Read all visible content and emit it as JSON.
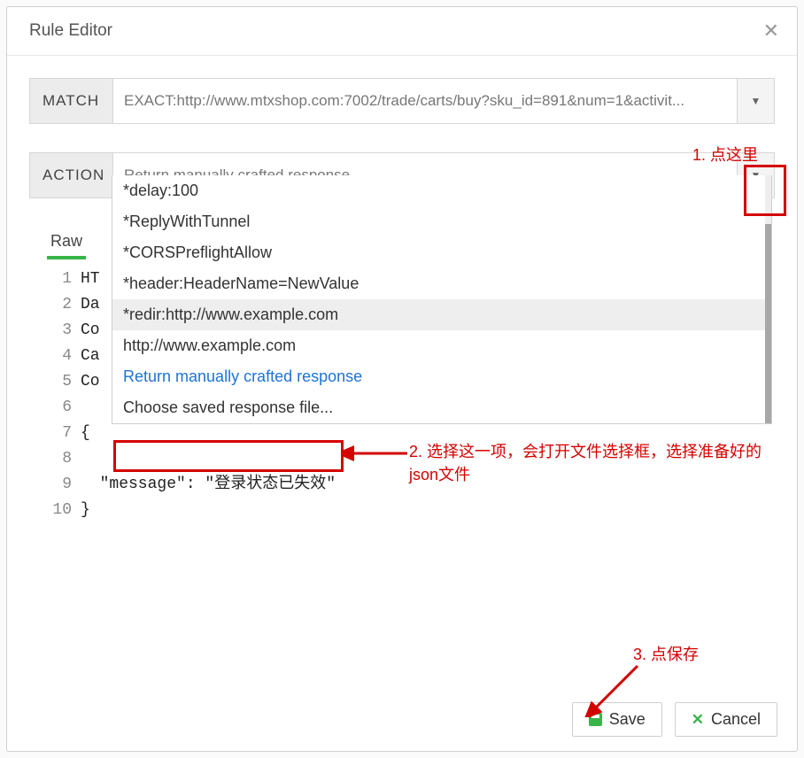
{
  "dialog": {
    "title": "Rule Editor"
  },
  "match": {
    "label": "MATCH",
    "value": "EXACT:http://www.mtxshop.com:7002/trade/carts/buy?sku_id=891&num=1&activit..."
  },
  "action": {
    "label": "ACTION",
    "value": "Return manually crafted response",
    "options": [
      "*delay:100",
      "*ReplyWithTunnel",
      "*CORSPreflightAllow",
      "*header:HeaderName=NewValue",
      "*redir:http://www.example.com",
      "http://www.example.com",
      "Return manually crafted response",
      "Choose saved response file..."
    ]
  },
  "tabs": {
    "raw": "Raw"
  },
  "editor_lines": [
    "HT",
    "Da",
    "Co",
    "Ca",
    "Co",
    "",
    "{",
    "",
    "  \"message\": \"登录状态已失效\"",
    "}"
  ],
  "annotations": {
    "a1": "1. 点这里",
    "a2": "2. 选择这一项，会打开文件选择框，选择准备好的json文件",
    "a3": "3. 点保存"
  },
  "footer": {
    "save": "Save",
    "cancel": "Cancel"
  }
}
